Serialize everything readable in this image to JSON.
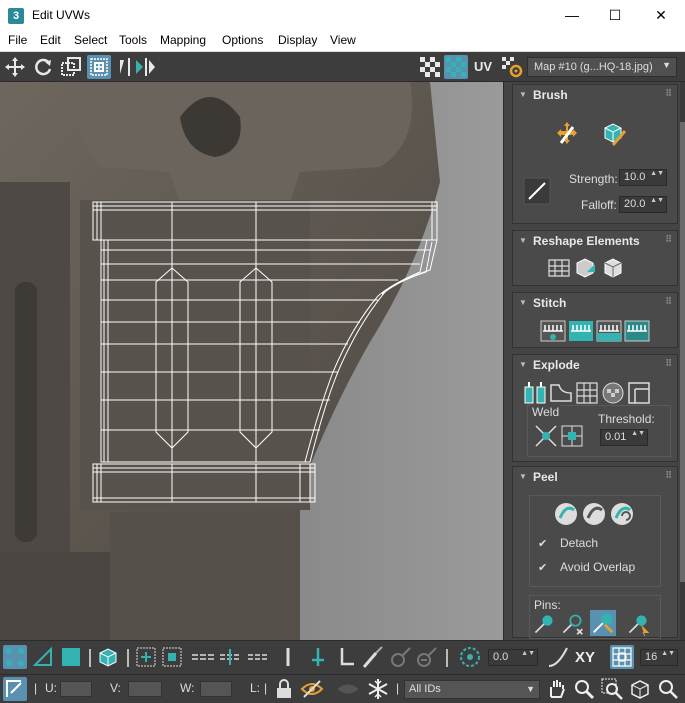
{
  "window": {
    "app_icon": "3",
    "title": "Edit UVWs",
    "controls": {
      "minimize": "—",
      "maximize": "☐",
      "close": "✕"
    }
  },
  "menu": [
    "File",
    "Edit",
    "Select",
    "Tools",
    "Mapping",
    "Options",
    "Display",
    "View"
  ],
  "toolbar": {
    "uv_label": "UV",
    "map_select": "Map #10 (g...HQ-18.jpg)",
    "map_arrow": "▼"
  },
  "panel": {
    "brush": {
      "title": "Brush",
      "strength_label": "Strength:",
      "strength_value": "10.0",
      "falloff_label": "Falloff:",
      "falloff_value": "20.0"
    },
    "reshape": {
      "title": "Reshape Elements"
    },
    "stitch": {
      "title": "Stitch"
    },
    "explode": {
      "title": "Explode",
      "weld_label": "Weld",
      "threshold_label": "Threshold:",
      "threshold_value": "0.01"
    },
    "peel": {
      "title": "Peel",
      "detach_label": "Detach",
      "detach_checked": true,
      "avoid_overlap_label": "Avoid Overlap",
      "avoid_overlap_checked": true,
      "pins_label": "Pins:"
    },
    "collapse_glyph": "▼",
    "grip_glyph": "⠿",
    "spin_glyph": "▲▼",
    "check_glyph": "✔"
  },
  "bottom": {
    "rotate_value": "0.0",
    "xy_label": "XY",
    "grid_value": "16",
    "u_label": "U:",
    "v_label": "V:",
    "w_label": "W:",
    "l_label": "L:",
    "ids_select": "All IDs",
    "sep": "|"
  },
  "colors": {
    "accent_teal": "#34b3b3",
    "active_blue": "#5a90b0",
    "panel_bg": "#444444",
    "wire": "#ffffff"
  }
}
